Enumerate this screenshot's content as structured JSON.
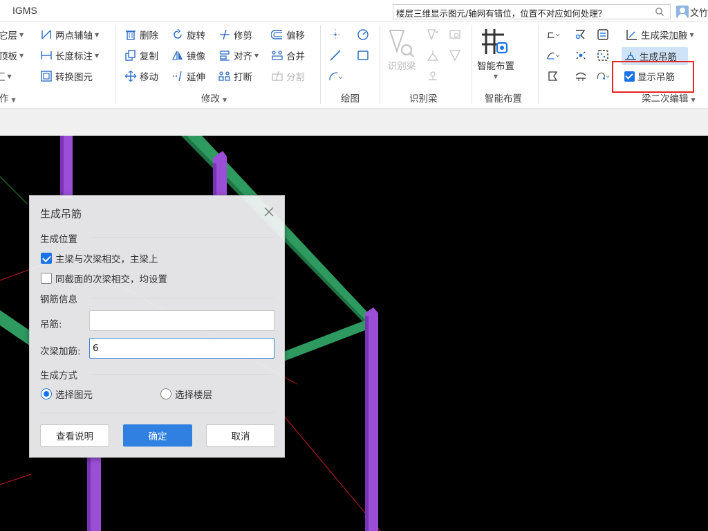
{
  "app": {
    "title": "IGMS",
    "search_text": "楼层三维显示图元/轴网有错位，位置不对应如何处理？",
    "user_text": "文竹"
  },
  "ribbon": {
    "floor_group": {
      "items": [
        "它层",
        "顶板",
        "汇"
      ],
      "label": "作"
    },
    "axis_group": {
      "two_point_axis": "两点辅轴",
      "length_dim": "长度标注",
      "convert_elem": "转换图元"
    },
    "modify_group": {
      "label": "修改",
      "delete": "删除",
      "rotate": "旋转",
      "trim": "修剪",
      "offset": "偏移",
      "copy": "复制",
      "mirror": "镜像",
      "align": "对齐",
      "merge": "合并",
      "move": "移动",
      "extend": "延伸",
      "break": "打断",
      "split": "分割"
    },
    "draw_group": {
      "label": "绘图"
    },
    "identify_group": {
      "label": "识别梁",
      "big_button": "识别梁"
    },
    "smart_group": {
      "label": "智能布置",
      "big_button": "智能布置"
    },
    "beam_edit_group": {
      "label": "梁二次编辑",
      "gen_haunch": "生成梁加腋",
      "gen_hanger": "生成吊筋",
      "show_hanger": "显示吊筋"
    }
  },
  "dialog": {
    "title": "生成吊筋",
    "section_position": "生成位置",
    "opt_main_secondary": "主梁与次梁相交，主梁上",
    "opt_main_secondary_checked": true,
    "opt_same_section": "同截面的次梁相交，均设置",
    "opt_same_section_checked": false,
    "section_rebar": "钢筋信息",
    "hanger_label": "吊筋:",
    "hanger_value": "",
    "secondary_label": "次梁加筋:",
    "secondary_value": "6",
    "section_method": "生成方式",
    "method_select_elem": "选择图元",
    "method_select_floor": "选择楼层",
    "method_selected": "选择图元",
    "btn_help": "查看说明",
    "btn_ok": "确定",
    "btn_cancel": "取消"
  },
  "colors": {
    "accent": "#2f80e0",
    "column": "#9b4fd6",
    "beam": "#2e9a60",
    "highlight_frame": "#e6261f"
  }
}
